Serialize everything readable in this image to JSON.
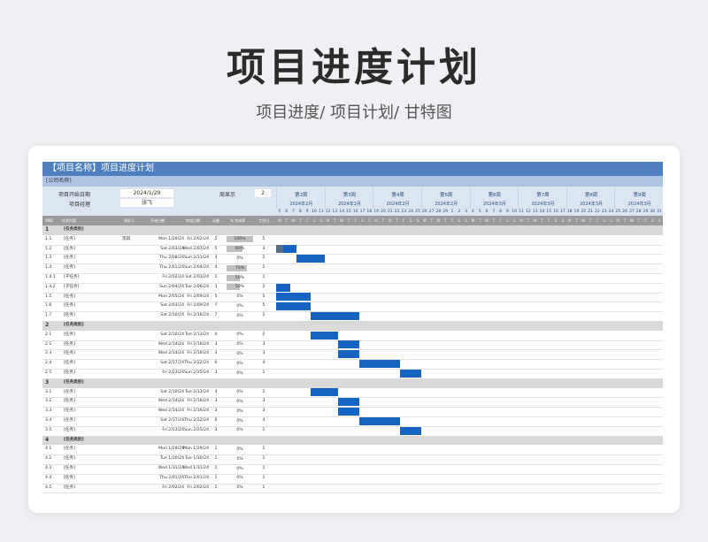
{
  "hero": {
    "title": "项目进度计划",
    "subtitle": "项目进度/  项目计划/  甘特图"
  },
  "sheet": {
    "title": "【项目名称】项目进度计划",
    "company": "[公司名称]",
    "start_label": "项目开始日期",
    "start_value": "2024/1/29",
    "lead_label": "项目经理",
    "lead_value": "张飞",
    "week_show_label": "周显示",
    "week_show_value": "2",
    "weeks": [
      {
        "label": "第2周",
        "month": "2024年2月"
      },
      {
        "label": "第3周",
        "month": "2024年2月"
      },
      {
        "label": "第4周",
        "month": "2024年2月"
      },
      {
        "label": "第5周",
        "month": "2024年2月"
      },
      {
        "label": "第6周",
        "month": "2024年3月"
      },
      {
        "label": "第7周",
        "month": "2024年3月"
      },
      {
        "label": "第8周",
        "month": "2024年3月"
      },
      {
        "label": "第9周",
        "month": "2024年3月"
      }
    ],
    "day_numbers": [
      "5",
      "6",
      "7",
      "8",
      "9",
      "10",
      "11",
      "12",
      "13",
      "14",
      "15",
      "16",
      "17",
      "18",
      "19",
      "20",
      "21",
      "22",
      "23",
      "24",
      "25",
      "26",
      "27",
      "28",
      "29",
      "1",
      "2",
      "3",
      "4",
      "5",
      "6",
      "7",
      "8",
      "9",
      "10",
      "11",
      "12",
      "13",
      "14",
      "15",
      "16",
      "17",
      "18",
      "19",
      "20",
      "21",
      "22",
      "23",
      "24",
      "25",
      "26",
      "27",
      "28",
      "29",
      "30",
      "31"
    ],
    "day_letters": [
      "M",
      "T",
      "W",
      "T",
      "F",
      "S",
      "S"
    ],
    "columns": {
      "wbs": "WBS",
      "task": "任务内容",
      "owner": "责任人",
      "start": "开始日期",
      "end": "完成日期",
      "days": "天数",
      "pct": "% 完成率",
      "work": "工作日"
    },
    "colors": {
      "accent": "#4f7fbf",
      "bar": "#1565c0",
      "bar_done": "#5a6d86",
      "phase": "#d9d9d9"
    }
  },
  "rows": [
    {
      "type": "phase",
      "wbs": "1",
      "task": "[任务类别]"
    },
    {
      "wbs": "1.1",
      "task": "[任务]",
      "owner": "李四",
      "start": "Mon 1/29/24",
      "end": "Fri 2/02/24",
      "days": "5",
      "pct": "100%",
      "pct_value": 1.0,
      "work": "5",
      "bar": null
    },
    {
      "wbs": "1.2",
      "task": "[任务]",
      "owner": "",
      "start": "Sat 2/03/24",
      "end": "Wed 2/07/24",
      "days": "5",
      "pct": "60%",
      "pct_value": 0.6,
      "work": "3",
      "bar": [
        0,
        3
      ],
      "done": 1
    },
    {
      "wbs": "1.3",
      "task": "[任务]",
      "owner": "",
      "start": "Thu 2/08/24",
      "end": "Sun 2/11/24",
      "days": "4",
      "pct": "0%",
      "pct_value": 0,
      "work": "2",
      "bar": [
        3,
        4
      ]
    },
    {
      "wbs": "1.4",
      "task": "[任务]",
      "owner": "",
      "start": "Thu 2/01/24",
      "end": "Sun 2/04/24",
      "days": "4",
      "pct": "75%",
      "pct_value": 0.75,
      "work": "2",
      "bar": null
    },
    {
      "wbs": "1.4.1",
      "task": "[子任务]",
      "owner": "",
      "start": "Fri 2/02/24",
      "end": "Sat 2/03/24",
      "days": "2",
      "pct": "50%",
      "pct_value": 0.5,
      "work": "1",
      "bar": null
    },
    {
      "wbs": "1.4.2",
      "task": "[子任务]",
      "owner": "",
      "start": "Sun 2/04/24",
      "end": "Tue 2/06/24",
      "days": "3",
      "pct": "50%",
      "pct_value": 0.5,
      "work": "2",
      "bar": [
        0,
        2
      ]
    },
    {
      "wbs": "1.5",
      "task": "[任务]",
      "owner": "",
      "start": "Mon 2/05/24",
      "end": "Fri 2/09/24",
      "days": "5",
      "pct": "0%",
      "pct_value": 0,
      "work": "5",
      "bar": [
        0,
        5
      ]
    },
    {
      "wbs": "1.6",
      "task": "[任务]",
      "owner": "",
      "start": "Sat 2/03/24",
      "end": "Fri 2/09/24",
      "days": "7",
      "pct": "0%",
      "pct_value": 0,
      "work": "5",
      "bar": [
        0,
        5
      ]
    },
    {
      "wbs": "1.7",
      "task": "[任务]",
      "owner": "",
      "start": "Sat 2/10/24",
      "end": "Fri 2/16/24",
      "days": "7",
      "pct": "0%",
      "pct_value": 0,
      "work": "5",
      "bar": [
        5,
        7
      ]
    },
    {
      "type": "phase",
      "wbs": "2",
      "task": "[任务类别]"
    },
    {
      "wbs": "2.1",
      "task": "[任务]",
      "owner": "",
      "start": "Sat 2/10/24",
      "end": "Tue 2/13/24",
      "days": "4",
      "pct": "0%",
      "pct_value": 0,
      "work": "2",
      "bar": [
        5,
        4
      ]
    },
    {
      "wbs": "2.2",
      "task": "[任务]",
      "owner": "",
      "start": "Wed 2/14/24",
      "end": "Fri 2/16/24",
      "days": "3",
      "pct": "0%",
      "pct_value": 0,
      "work": "3",
      "bar": [
        9,
        3
      ]
    },
    {
      "wbs": "2.3",
      "task": "[任务]",
      "owner": "",
      "start": "Wed 2/14/24",
      "end": "Fri 2/16/24",
      "days": "3",
      "pct": "0%",
      "pct_value": 0,
      "work": "3",
      "bar": [
        9,
        3
      ]
    },
    {
      "wbs": "2.4",
      "task": "[任务]",
      "owner": "",
      "start": "Sat 2/17/24",
      "end": "Thu 2/22/24",
      "days": "6",
      "pct": "0%",
      "pct_value": 0,
      "work": "4",
      "bar": [
        12,
        6
      ]
    },
    {
      "wbs": "2.5",
      "task": "[任务]",
      "owner": "",
      "start": "Fri 2/23/24",
      "end": "Sun 2/25/24",
      "days": "3",
      "pct": "0%",
      "pct_value": 0,
      "work": "1",
      "bar": [
        18,
        3
      ]
    },
    {
      "type": "phase",
      "wbs": "3",
      "task": "[任务类别]"
    },
    {
      "wbs": "3.1",
      "task": "[任务]",
      "owner": "",
      "start": "Sat 2/10/24",
      "end": "Tue 2/13/24",
      "days": "4",
      "pct": "0%",
      "pct_value": 0,
      "work": "2",
      "bar": [
        5,
        4
      ]
    },
    {
      "wbs": "3.2",
      "task": "[任务]",
      "owner": "",
      "start": "Wed 2/14/24",
      "end": "Fri 2/16/24",
      "days": "3",
      "pct": "0%",
      "pct_value": 0,
      "work": "3",
      "bar": [
        9,
        3
      ]
    },
    {
      "wbs": "3.3",
      "task": "[任务]",
      "owner": "",
      "start": "Wed 2/14/24",
      "end": "Fri 2/16/24",
      "days": "3",
      "pct": "0%",
      "pct_value": 0,
      "work": "3",
      "bar": [
        9,
        3
      ]
    },
    {
      "wbs": "3.4",
      "task": "[任务]",
      "owner": "",
      "start": "Sat 2/17/24",
      "end": "Thu 2/22/24",
      "days": "6",
      "pct": "0%",
      "pct_value": 0,
      "work": "4",
      "bar": [
        12,
        6
      ]
    },
    {
      "wbs": "3.5",
      "task": "[任务]",
      "owner": "",
      "start": "Fri 2/23/24",
      "end": "Sun 2/25/24",
      "days": "3",
      "pct": "0%",
      "pct_value": 0,
      "work": "1",
      "bar": [
        18,
        3
      ]
    },
    {
      "type": "phase",
      "wbs": "4",
      "task": "[任务类别]"
    },
    {
      "wbs": "4.1",
      "task": "[任务]",
      "owner": "",
      "start": "Mon 1/29/24",
      "end": "Mon 1/29/24",
      "days": "1",
      "pct": "0%",
      "pct_value": 0,
      "work": "1",
      "bar": null
    },
    {
      "wbs": "4.2",
      "task": "[任务]",
      "owner": "",
      "start": "Tue 1/30/24",
      "end": "Tue 1/30/24",
      "days": "1",
      "pct": "0%",
      "pct_value": 0,
      "work": "1",
      "bar": null
    },
    {
      "wbs": "4.3",
      "task": "[任务]",
      "owner": "",
      "start": "Wed 1/31/24",
      "end": "Wed 1/31/24",
      "days": "1",
      "pct": "0%",
      "pct_value": 0,
      "work": "1",
      "bar": null
    },
    {
      "wbs": "4.4",
      "task": "[任务]",
      "owner": "",
      "start": "Thu 2/01/24",
      "end": "Thu 2/01/24",
      "days": "1",
      "pct": "0%",
      "pct_value": 0,
      "work": "1",
      "bar": null
    },
    {
      "wbs": "4.5",
      "task": "[任务]",
      "owner": "",
      "start": "Fri 2/02/24",
      "end": "Fri 2/02/24",
      "days": "1",
      "pct": "0%",
      "pct_value": 0,
      "work": "1",
      "bar": null
    }
  ]
}
